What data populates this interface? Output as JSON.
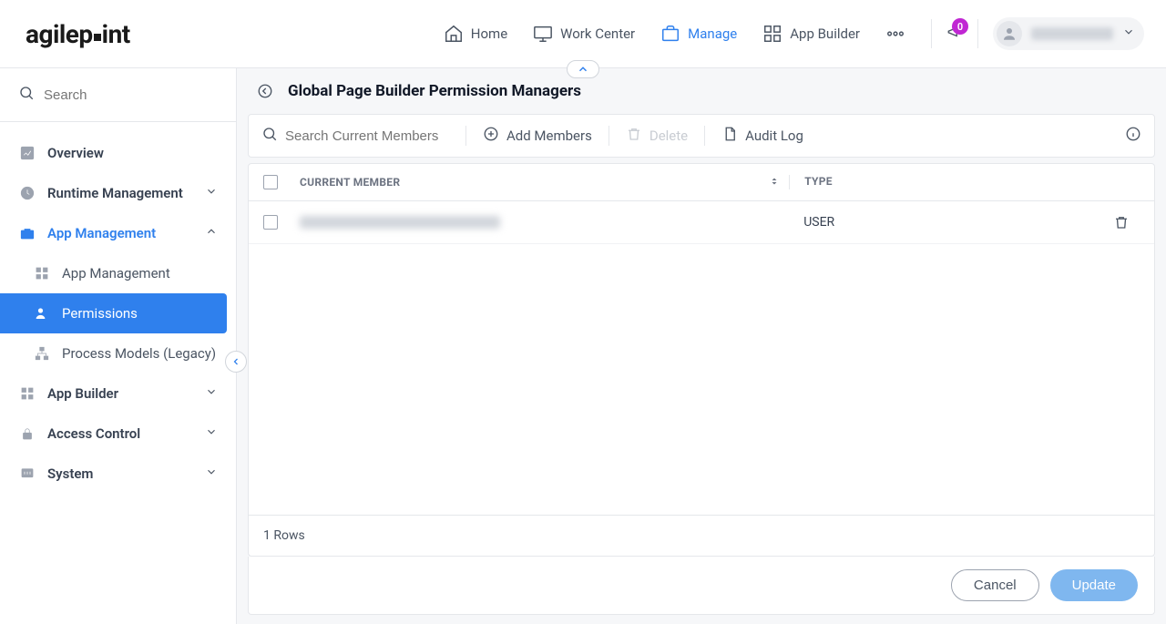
{
  "brand": {
    "name_left": "agilep",
    "name_right": "int"
  },
  "topnav": {
    "home": "Home",
    "work_center": "Work Center",
    "manage": "Manage",
    "app_builder": "App Builder"
  },
  "notifications": {
    "count": "0"
  },
  "sidebar": {
    "search_placeholder": "Search",
    "overview": "Overview",
    "runtime": "Runtime Management",
    "app_mgmt": "App Management",
    "sub_app_mgmt": "App Management",
    "sub_permissions": "Permissions",
    "sub_process_models": "Process Models (Legacy)",
    "app_builder": "App Builder",
    "access_control": "Access Control",
    "system": "System"
  },
  "page": {
    "title": "Global Page Builder Permission Managers",
    "toolbar": {
      "search_placeholder": "Search Current Members",
      "add_members": "Add Members",
      "delete": "Delete",
      "audit_log": "Audit Log"
    },
    "table": {
      "col_member": "CURRENT MEMBER",
      "col_type": "TYPE",
      "rows": [
        {
          "type": "USER"
        }
      ],
      "footer": "1 Rows"
    },
    "actions": {
      "cancel": "Cancel",
      "update": "Update"
    }
  }
}
